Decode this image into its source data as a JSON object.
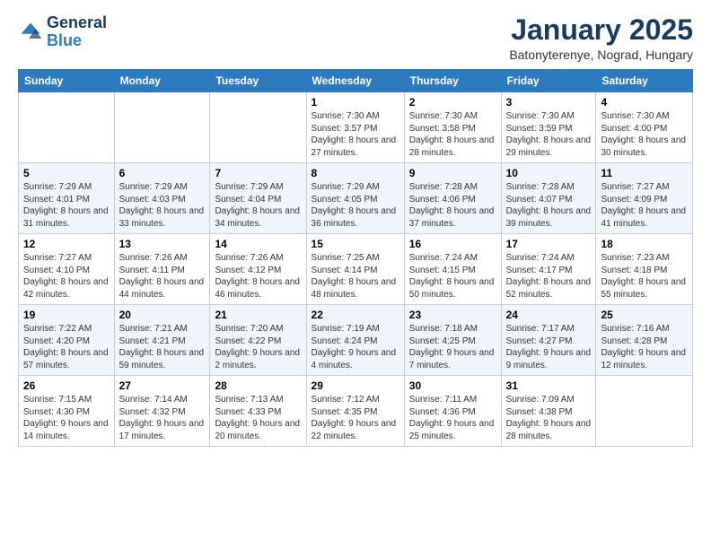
{
  "header": {
    "logo": {
      "general": "General",
      "blue": "Blue"
    },
    "title": "January 2025",
    "subtitle": "Batonyterenye, Nograd, Hungary"
  },
  "weekdays": [
    "Sunday",
    "Monday",
    "Tuesday",
    "Wednesday",
    "Thursday",
    "Friday",
    "Saturday"
  ],
  "weeks": [
    [
      {
        "num": "",
        "info": ""
      },
      {
        "num": "",
        "info": ""
      },
      {
        "num": "",
        "info": ""
      },
      {
        "num": "1",
        "info": "Sunrise: 7:30 AM\nSunset: 3:57 PM\nDaylight: 8 hours and 27 minutes."
      },
      {
        "num": "2",
        "info": "Sunrise: 7:30 AM\nSunset: 3:58 PM\nDaylight: 8 hours and 28 minutes."
      },
      {
        "num": "3",
        "info": "Sunrise: 7:30 AM\nSunset: 3:59 PM\nDaylight: 8 hours and 29 minutes."
      },
      {
        "num": "4",
        "info": "Sunrise: 7:30 AM\nSunset: 4:00 PM\nDaylight: 8 hours and 30 minutes."
      }
    ],
    [
      {
        "num": "5",
        "info": "Sunrise: 7:29 AM\nSunset: 4:01 PM\nDaylight: 8 hours and 31 minutes."
      },
      {
        "num": "6",
        "info": "Sunrise: 7:29 AM\nSunset: 4:03 PM\nDaylight: 8 hours and 33 minutes."
      },
      {
        "num": "7",
        "info": "Sunrise: 7:29 AM\nSunset: 4:04 PM\nDaylight: 8 hours and 34 minutes."
      },
      {
        "num": "8",
        "info": "Sunrise: 7:29 AM\nSunset: 4:05 PM\nDaylight: 8 hours and 36 minutes."
      },
      {
        "num": "9",
        "info": "Sunrise: 7:28 AM\nSunset: 4:06 PM\nDaylight: 8 hours and 37 minutes."
      },
      {
        "num": "10",
        "info": "Sunrise: 7:28 AM\nSunset: 4:07 PM\nDaylight: 8 hours and 39 minutes."
      },
      {
        "num": "11",
        "info": "Sunrise: 7:27 AM\nSunset: 4:09 PM\nDaylight: 8 hours and 41 minutes."
      }
    ],
    [
      {
        "num": "12",
        "info": "Sunrise: 7:27 AM\nSunset: 4:10 PM\nDaylight: 8 hours and 42 minutes."
      },
      {
        "num": "13",
        "info": "Sunrise: 7:26 AM\nSunset: 4:11 PM\nDaylight: 8 hours and 44 minutes."
      },
      {
        "num": "14",
        "info": "Sunrise: 7:26 AM\nSunset: 4:12 PM\nDaylight: 8 hours and 46 minutes."
      },
      {
        "num": "15",
        "info": "Sunrise: 7:25 AM\nSunset: 4:14 PM\nDaylight: 8 hours and 48 minutes."
      },
      {
        "num": "16",
        "info": "Sunrise: 7:24 AM\nSunset: 4:15 PM\nDaylight: 8 hours and 50 minutes."
      },
      {
        "num": "17",
        "info": "Sunrise: 7:24 AM\nSunset: 4:17 PM\nDaylight: 8 hours and 52 minutes."
      },
      {
        "num": "18",
        "info": "Sunrise: 7:23 AM\nSunset: 4:18 PM\nDaylight: 8 hours and 55 minutes."
      }
    ],
    [
      {
        "num": "19",
        "info": "Sunrise: 7:22 AM\nSunset: 4:20 PM\nDaylight: 8 hours and 57 minutes."
      },
      {
        "num": "20",
        "info": "Sunrise: 7:21 AM\nSunset: 4:21 PM\nDaylight: 8 hours and 59 minutes."
      },
      {
        "num": "21",
        "info": "Sunrise: 7:20 AM\nSunset: 4:22 PM\nDaylight: 9 hours and 2 minutes."
      },
      {
        "num": "22",
        "info": "Sunrise: 7:19 AM\nSunset: 4:24 PM\nDaylight: 9 hours and 4 minutes."
      },
      {
        "num": "23",
        "info": "Sunrise: 7:18 AM\nSunset: 4:25 PM\nDaylight: 9 hours and 7 minutes."
      },
      {
        "num": "24",
        "info": "Sunrise: 7:17 AM\nSunset: 4:27 PM\nDaylight: 9 hours and 9 minutes."
      },
      {
        "num": "25",
        "info": "Sunrise: 7:16 AM\nSunset: 4:28 PM\nDaylight: 9 hours and 12 minutes."
      }
    ],
    [
      {
        "num": "26",
        "info": "Sunrise: 7:15 AM\nSunset: 4:30 PM\nDaylight: 9 hours and 14 minutes."
      },
      {
        "num": "27",
        "info": "Sunrise: 7:14 AM\nSunset: 4:32 PM\nDaylight: 9 hours and 17 minutes."
      },
      {
        "num": "28",
        "info": "Sunrise: 7:13 AM\nSunset: 4:33 PM\nDaylight: 9 hours and 20 minutes."
      },
      {
        "num": "29",
        "info": "Sunrise: 7:12 AM\nSunset: 4:35 PM\nDaylight: 9 hours and 22 minutes."
      },
      {
        "num": "30",
        "info": "Sunrise: 7:11 AM\nSunset: 4:36 PM\nDaylight: 9 hours and 25 minutes."
      },
      {
        "num": "31",
        "info": "Sunrise: 7:09 AM\nSunset: 4:38 PM\nDaylight: 9 hours and 28 minutes."
      },
      {
        "num": "",
        "info": ""
      }
    ]
  ]
}
